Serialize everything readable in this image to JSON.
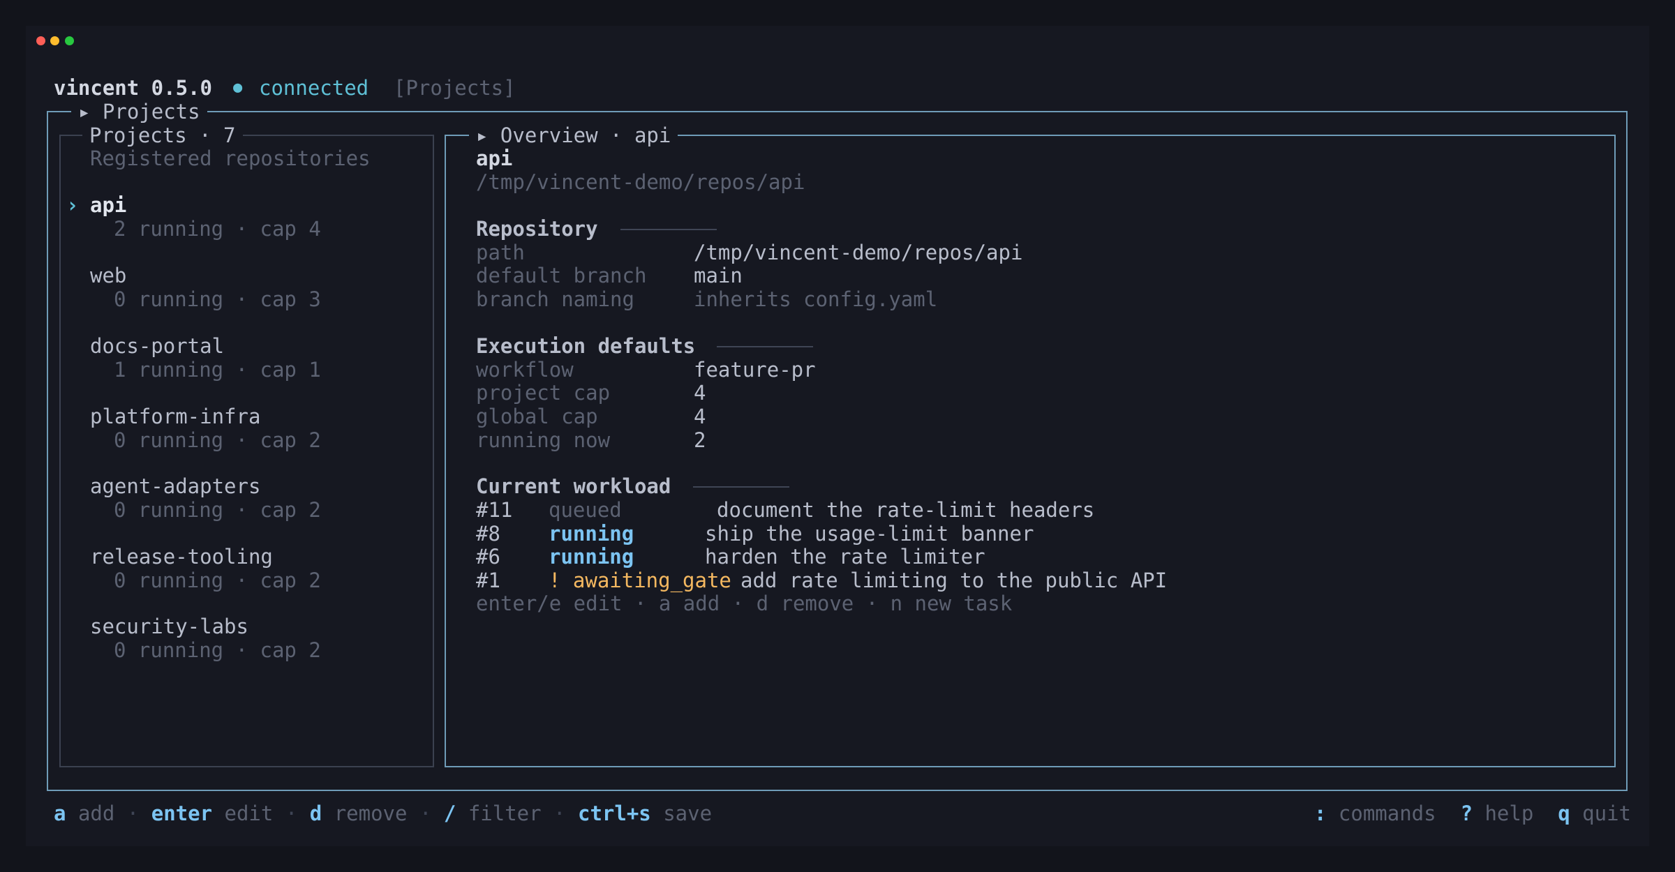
{
  "window": {
    "colors": {
      "close": "#ff5f57",
      "minimize": "#febc2e",
      "zoom": "#28c840"
    }
  },
  "header": {
    "app_name": "vincent 0.5.0",
    "status_dot": "●",
    "status": "connected",
    "view_tag": "[Projects]"
  },
  "outer": {
    "title": "▸ Projects"
  },
  "sidebar": {
    "title": "Projects · 7",
    "subtitle": "Registered repositories",
    "selected_marker": "›",
    "items": [
      {
        "name": "api",
        "meta": "2 running · cap 4"
      },
      {
        "name": "web",
        "meta": "0 running · cap 3"
      },
      {
        "name": "docs-portal",
        "meta": "1 running · cap 1"
      },
      {
        "name": "platform-infra",
        "meta": "0 running · cap 2"
      },
      {
        "name": "agent-adapters",
        "meta": "0 running · cap 2"
      },
      {
        "name": "release-tooling",
        "meta": "0 running · cap 2"
      },
      {
        "name": "security-labs",
        "meta": "0 running · cap 2"
      }
    ]
  },
  "overview": {
    "title": "▸ Overview · api",
    "project_name": "api",
    "project_path": "/tmp/vincent-demo/repos/api",
    "repository": {
      "heading": "Repository",
      "rows": [
        {
          "label": "path",
          "value": "/tmp/vincent-demo/repos/api"
        },
        {
          "label": "default branch",
          "value": "main"
        },
        {
          "label": "branch naming",
          "value": "inherits config.yaml"
        }
      ]
    },
    "execution": {
      "heading": "Execution defaults",
      "rows": [
        {
          "label": "workflow",
          "value": "feature-pr"
        },
        {
          "label": "project cap",
          "value": "4"
        },
        {
          "label": "global cap",
          "value": "4"
        },
        {
          "label": "running now",
          "value": "2"
        }
      ]
    },
    "workload": {
      "heading": "Current workload",
      "tasks": [
        {
          "id": "#11",
          "status": "queued",
          "title": "document the rate-limit headers"
        },
        {
          "id": "#8",
          "status": "running",
          "title": "ship the usage-limit banner"
        },
        {
          "id": "#6",
          "status": "running",
          "title": "harden the rate limiter"
        },
        {
          "id": "#1",
          "status": "! awaiting_gate",
          "title": "add rate limiting to the public API"
        }
      ],
      "hint": "enter/e edit · a add · d remove · n new task"
    }
  },
  "footer": {
    "left": [
      {
        "key": "a",
        "label": "add"
      },
      {
        "key": "enter",
        "label": "edit"
      },
      {
        "key": "d",
        "label": "remove"
      },
      {
        "key": "/",
        "label": "filter"
      },
      {
        "key": "ctrl+s",
        "label": "save"
      }
    ],
    "separator": "·",
    "right": [
      {
        "key": ":",
        "label": "commands"
      },
      {
        "key": "?",
        "label": "help"
      },
      {
        "key": "q",
        "label": "quit"
      }
    ]
  }
}
